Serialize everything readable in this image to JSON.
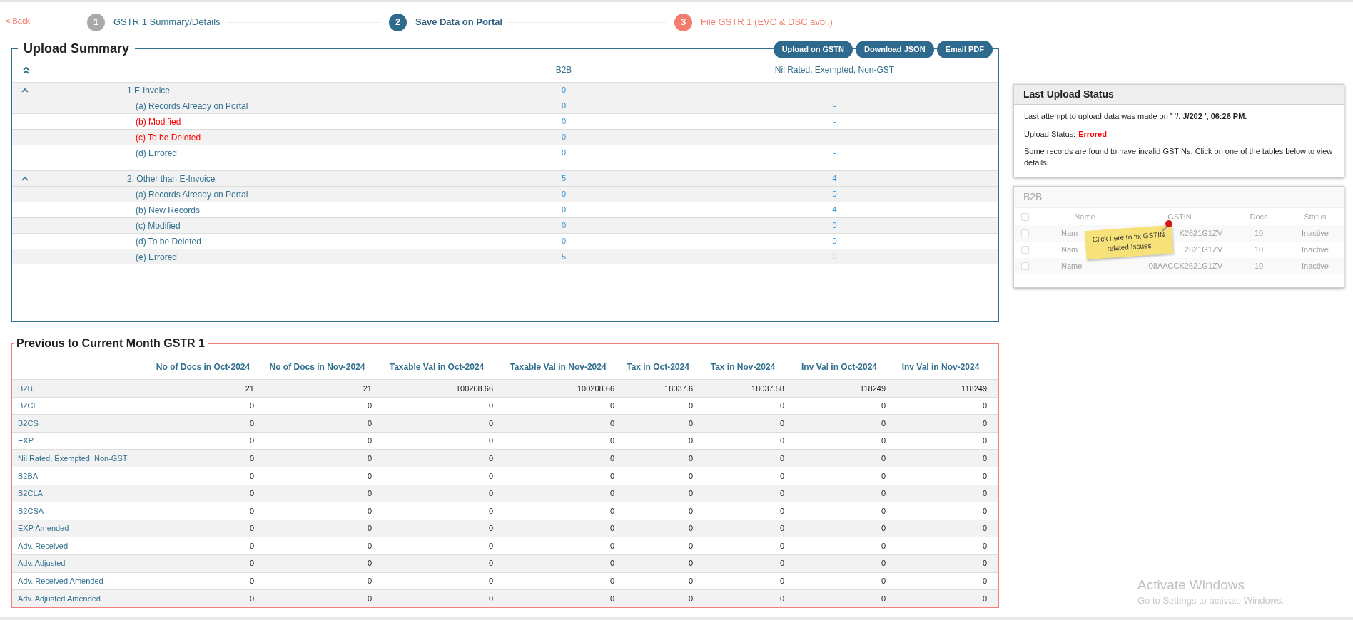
{
  "back_link": "< Back",
  "steps": [
    {
      "number": "1",
      "label": "GSTR 1 Summary/Details",
      "kind": "done"
    },
    {
      "number": "2",
      "label": "Save Data on Portal",
      "kind": "current"
    },
    {
      "number": "3",
      "label": "File GSTR 1 (EVC & DSC avbl.)",
      "kind": "upcoming"
    }
  ],
  "upload_summary": {
    "title": "Upload Summary",
    "buttons": [
      "Upload on GSTN",
      "Download JSON",
      "Email PDF"
    ],
    "columns": [
      "B2B",
      "Nil Rated, Exempted, Non-GST"
    ],
    "sections": [
      {
        "label": "1.E-Invoice",
        "expanded": true,
        "b2b": "0",
        "nil": "-",
        "rows": [
          {
            "label": "(a) Records Already on Portal",
            "alert": false,
            "b2b": "0",
            "nil": "-"
          },
          {
            "label": "(b) Modified",
            "alert": true,
            "b2b": "0",
            "nil": "-"
          },
          {
            "label": "(c) To be Deleted",
            "alert": true,
            "b2b": "0",
            "nil": "-"
          },
          {
            "label": "(d) Errored",
            "alert": false,
            "b2b": "0",
            "nil": "-"
          }
        ]
      },
      {
        "label": "2. Other than E-Invoice",
        "expanded": true,
        "b2b": "5",
        "nil": "4",
        "rows": [
          {
            "label": "(a) Records Already on Portal",
            "alert": false,
            "b2b": "0",
            "nil": "0"
          },
          {
            "label": "(b) New Records",
            "alert": false,
            "b2b": "0",
            "nil": "4"
          },
          {
            "label": "(c) Modified",
            "alert": false,
            "b2b": "0",
            "nil": "0"
          },
          {
            "label": "(d) To be Deleted",
            "alert": false,
            "b2b": "0",
            "nil": "0"
          },
          {
            "label": "(e) Errored",
            "alert": false,
            "b2b": "5",
            "nil": "0"
          }
        ]
      }
    ]
  },
  "previous_month": {
    "title": "Previous to Current Month GSTR 1",
    "columns": [
      "No of Docs in Oct-2024",
      "No of Docs in Nov-2024",
      "Taxable Val in Oct-2024",
      "Taxable Val in Nov-2024",
      "Tax in Oct-2024",
      "Tax in Nov-2024",
      "Inv Val in Oct-2024",
      "Inv Val in Nov-2024"
    ],
    "rows": [
      {
        "label": "B2B",
        "values": [
          "21",
          "21",
          "100208.66",
          "100208.66",
          "18037.6",
          "18037.58",
          "118249",
          "118249"
        ]
      },
      {
        "label": "B2CL",
        "values": [
          "0",
          "0",
          "0",
          "0",
          "0",
          "0",
          "0",
          "0"
        ]
      },
      {
        "label": "B2CS",
        "values": [
          "0",
          "0",
          "0",
          "0",
          "0",
          "0",
          "0",
          "0"
        ]
      },
      {
        "label": "EXP",
        "values": [
          "0",
          "0",
          "0",
          "0",
          "0",
          "0",
          "0",
          "0"
        ]
      },
      {
        "label": "Nil Rated, Exempted, Non-GST",
        "values": [
          "0",
          "0",
          "0",
          "0",
          "0",
          "0",
          "0",
          "0"
        ]
      },
      {
        "label": "B2BA",
        "values": [
          "0",
          "0",
          "0",
          "0",
          "0",
          "0",
          "0",
          "0"
        ]
      },
      {
        "label": "B2CLA",
        "values": [
          "0",
          "0",
          "0",
          "0",
          "0",
          "0",
          "0",
          "0"
        ]
      },
      {
        "label": "B2CSA",
        "values": [
          "0",
          "0",
          "0",
          "0",
          "0",
          "0",
          "0",
          "0"
        ]
      },
      {
        "label": "EXP Amended",
        "values": [
          "0",
          "0",
          "0",
          "0",
          "0",
          "0",
          "0",
          "0"
        ]
      },
      {
        "label": "Adv. Received",
        "values": [
          "0",
          "0",
          "0",
          "0",
          "0",
          "0",
          "0",
          "0"
        ]
      },
      {
        "label": "Adv. Adjusted",
        "values": [
          "0",
          "0",
          "0",
          "0",
          "0",
          "0",
          "0",
          "0"
        ]
      },
      {
        "label": "Adv. Received Amended",
        "values": [
          "0",
          "0",
          "0",
          "0",
          "0",
          "0",
          "0",
          "0"
        ]
      },
      {
        "label": "Adv. Adjusted Amended",
        "values": [
          "0",
          "0",
          "0",
          "0",
          "0",
          "0",
          "0",
          "0"
        ]
      }
    ]
  },
  "last_upload_status": {
    "title": "Last Upload Status",
    "message": "Last attempt to upload data was made on **' '/. J/202 ', 06:26 PM.**",
    "status_label": "Upload Status:",
    "status": "Errored",
    "note": "Some records are found to have invalid GSTINs. Click on one of the tables below to view details."
  },
  "b2b_preview": {
    "title": "B2B",
    "all_checked": false,
    "columns": [
      "Name",
      "GSTIN",
      "Docs",
      "Status"
    ],
    "rows": [
      {
        "checked": false,
        "name": "Nam",
        "gstin": "K2621G1ZV",
        "docs": "10",
        "status": "Inactive"
      },
      {
        "checked": false,
        "name": "Nam",
        "gstin": "2621G1ZV",
        "docs": "10",
        "status": "Inactive"
      },
      {
        "checked": false,
        "name": "Name",
        "gstin": "08AACCK2621G1ZV",
        "docs": "10",
        "status": "Inactive"
      }
    ],
    "sticky_note": "Click here to fix GSTIN related Issues"
  },
  "os_notice": {
    "title": "Activate Windows",
    "text": "Go to Settings to activate Windows."
  }
}
